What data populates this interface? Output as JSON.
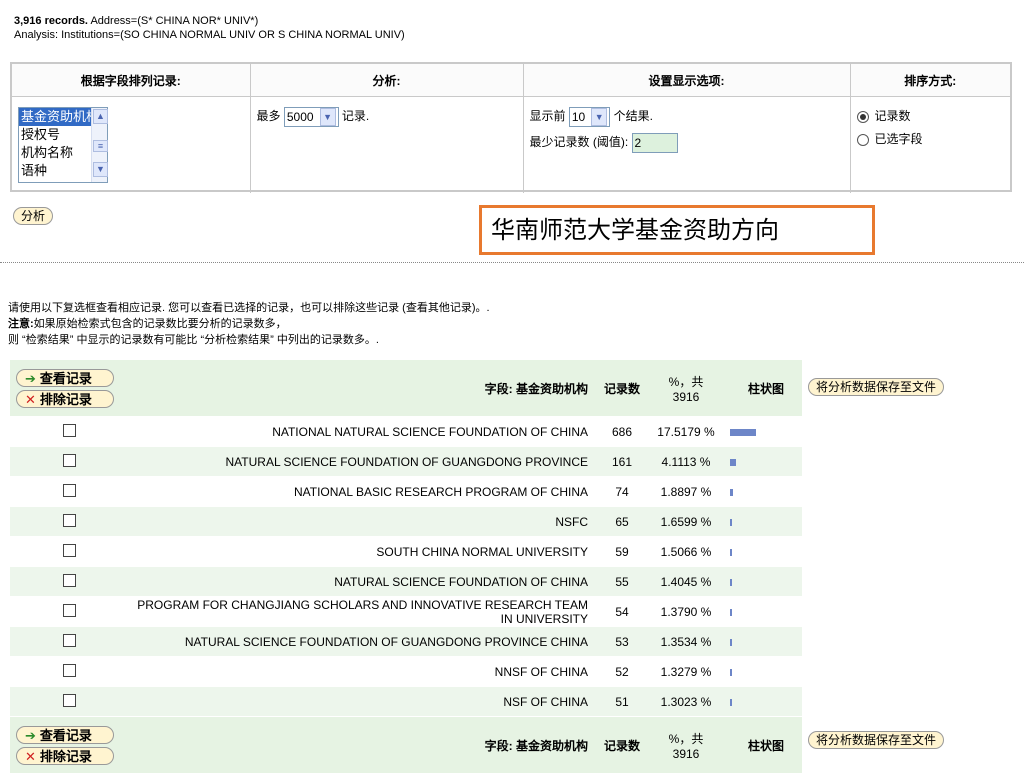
{
  "header": {
    "records_count": "3,916 records.",
    "address_query": "Address=(S* CHINA NOR* UNIV*)",
    "analysis_line": "Analysis: Institutions=(SO CHINA NORMAL UNIV OR S CHINA NORMAL UNIV)"
  },
  "options": {
    "col_rank_by": "根据字段排列记录:",
    "col_analyze": "分析:",
    "col_display": "设置显示选项:",
    "col_sort": "排序方式:",
    "field_list": [
      "基金资助机构",
      "授权号",
      "机构名称",
      "语种"
    ],
    "analyze_prefix": "最多",
    "analyze_value": "5000",
    "analyze_suffix": "记录.",
    "display_prefix": "显示前",
    "display_value": "10",
    "display_suffix": "个结果.",
    "min_count_label": "最少记录数 (阈值):",
    "min_count_value": "2",
    "sort_options": [
      "记录数",
      "已选字段"
    ]
  },
  "analyze_button": "分析",
  "callout": "华南师范大学基金资助方向",
  "info": {
    "line1": "请使用以下复选框查看相应记录. 您可以查看已选择的记录，也可以排除这些记录 (查看其他记录)。.",
    "note_label": "注意:",
    "line2": "如果原始检索式包含的记录数比要分析的记录数多，",
    "line3": "则 “检索结果” 中显示的记录数有可能比 “分析检索结果” 中列出的记录数多。."
  },
  "results": {
    "view_button": "查看记录",
    "exclude_button": "排除记录",
    "field_header": "字段: 基金资助机构",
    "count_header": "记录数",
    "pct_header_top": "%，共",
    "pct_header_bottom": "3916",
    "bar_header": "柱状图",
    "save_button": "将分析数据保存至文件",
    "rows": [
      {
        "name": "NATIONAL NATURAL SCIENCE FOUNDATION OF CHINA",
        "count": "686",
        "pct": "17.5179 %",
        "pct_value": 17.5179
      },
      {
        "name": "NATURAL SCIENCE FOUNDATION OF GUANGDONG PROVINCE",
        "count": "161",
        "pct": "4.1113 %",
        "pct_value": 4.1113
      },
      {
        "name": "NATIONAL BASIC RESEARCH PROGRAM OF CHINA",
        "count": "74",
        "pct": "1.8897 %",
        "pct_value": 1.8897
      },
      {
        "name": "NSFC",
        "count": "65",
        "pct": "1.6599 %",
        "pct_value": 1.6599
      },
      {
        "name": "SOUTH CHINA NORMAL UNIVERSITY",
        "count": "59",
        "pct": "1.5066 %",
        "pct_value": 1.5066
      },
      {
        "name": "NATURAL SCIENCE FOUNDATION OF CHINA",
        "count": "55",
        "pct": "1.4045 %",
        "pct_value": 1.4045
      },
      {
        "name": "PROGRAM FOR CHANGJIANG SCHOLARS AND INNOVATIVE RESEARCH TEAM IN UNIVERSITY",
        "count": "54",
        "pct": "1.3790 %",
        "pct_value": 1.379
      },
      {
        "name": "NATURAL SCIENCE FOUNDATION OF GUANGDONG PROVINCE CHINA",
        "count": "53",
        "pct": "1.3534 %",
        "pct_value": 1.3534
      },
      {
        "name": "NNSF OF CHINA",
        "count": "52",
        "pct": "1.3279 %",
        "pct_value": 1.3279
      },
      {
        "name": "NSF OF CHINA",
        "count": "51",
        "pct": "1.3023 %",
        "pct_value": 1.3023
      }
    ]
  },
  "colors": {
    "bar": "#6d86c8",
    "row_alt": "#edf6ec",
    "header_bg": "#e6f3e3",
    "callout_border": "#e8792e"
  }
}
